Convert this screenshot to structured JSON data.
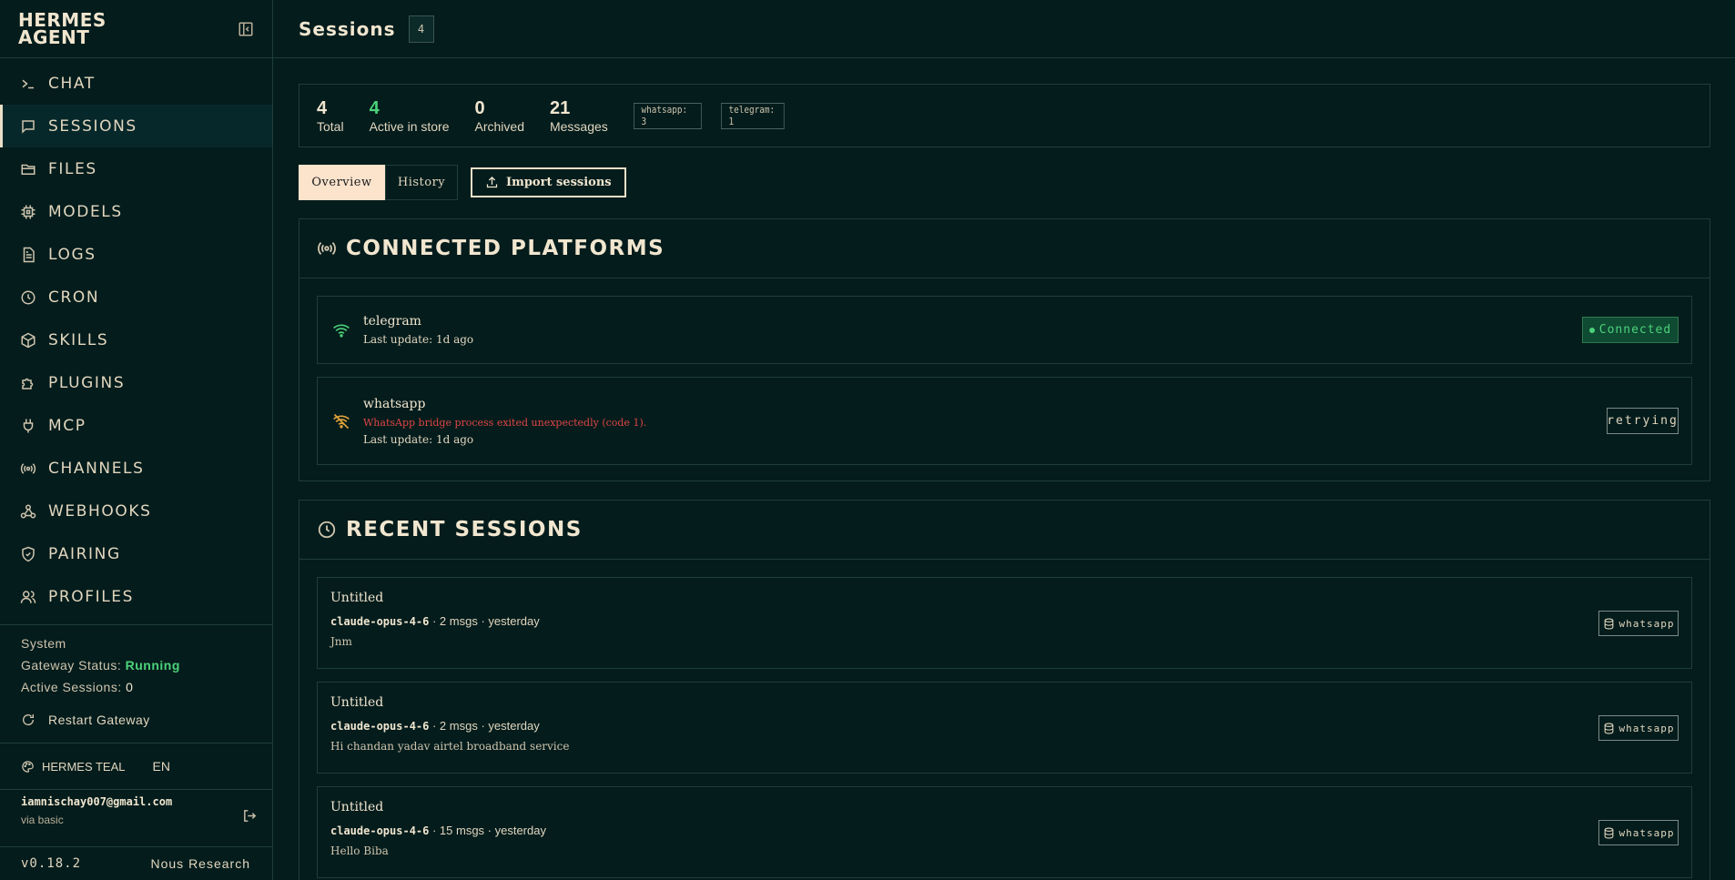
{
  "brand": {
    "name": "HERMES AGENT"
  },
  "nav": [
    {
      "label": "CHAT",
      "icon": "terminal-icon"
    },
    {
      "label": "SESSIONS",
      "icon": "message-icon"
    },
    {
      "label": "FILES",
      "icon": "folder-icon"
    },
    {
      "label": "MODELS",
      "icon": "cpu-icon"
    },
    {
      "label": "LOGS",
      "icon": "file-text-icon"
    },
    {
      "label": "CRON",
      "icon": "clock-icon"
    },
    {
      "label": "SKILLS",
      "icon": "package-icon"
    },
    {
      "label": "PLUGINS",
      "icon": "puzzle-icon"
    },
    {
      "label": "MCP",
      "icon": "plug-icon"
    },
    {
      "label": "CHANNELS",
      "icon": "radio-icon"
    },
    {
      "label": "WEBHOOKS",
      "icon": "webhook-icon"
    },
    {
      "label": "PAIRING",
      "icon": "shield-icon"
    },
    {
      "label": "PROFILES",
      "icon": "users-icon"
    }
  ],
  "system": {
    "heading": "System",
    "gateway_label": "Gateway Status:",
    "gateway_value": "Running",
    "active_label": "Active Sessions:",
    "active_value": "0",
    "restart_label": "Restart Gateway"
  },
  "theme": {
    "name": "HERMES TEAL",
    "lang": "EN"
  },
  "account": {
    "email": "iamnischay007@gmail.com",
    "via": "via basic"
  },
  "footer": {
    "version": "v0.18.2",
    "credit": "Nous Research"
  },
  "header": {
    "title": "Sessions",
    "count": "4"
  },
  "stats": [
    {
      "num": "4",
      "label": "Total"
    },
    {
      "num": "4",
      "label": "Active in store"
    },
    {
      "num": "0",
      "label": "Archived"
    },
    {
      "num": "21",
      "label": "Messages"
    }
  ],
  "chips": [
    "whatsapp: 3",
    "telegram: 1"
  ],
  "tabs": {
    "overview": "Overview",
    "history": "History",
    "import": "Import sessions"
  },
  "platforms": {
    "title": "CONNECTED PLATFORMS",
    "items": [
      {
        "name": "telegram",
        "error": "",
        "update": "Last update: 1d ago",
        "status": "Connected"
      },
      {
        "name": "whatsapp",
        "error": "WhatsApp bridge process exited unexpectedly (code 1).",
        "update": "Last update: 1d ago",
        "status": "retrying"
      }
    ]
  },
  "recent": {
    "title": "RECENT SESSIONS",
    "items": [
      {
        "title": "Untitled",
        "model": "claude-opus-4-6",
        "meta": " · 2 msgs · yesterday",
        "preview": "Jnm",
        "platform": "whatsapp"
      },
      {
        "title": "Untitled",
        "model": "claude-opus-4-6",
        "meta": " · 2 msgs · yesterday",
        "preview": "Hi chandan yadav airtel broadband service",
        "platform": "whatsapp"
      },
      {
        "title": "Untitled",
        "model": "claude-opus-4-6",
        "meta": " · 15 msgs · yesterday",
        "preview": "Hello Biba",
        "platform": "whatsapp"
      }
    ]
  },
  "colors": {
    "background": "#041c1c",
    "accent": "#fbe3cc",
    "success": "#4bd27a",
    "error": "#e24444"
  }
}
